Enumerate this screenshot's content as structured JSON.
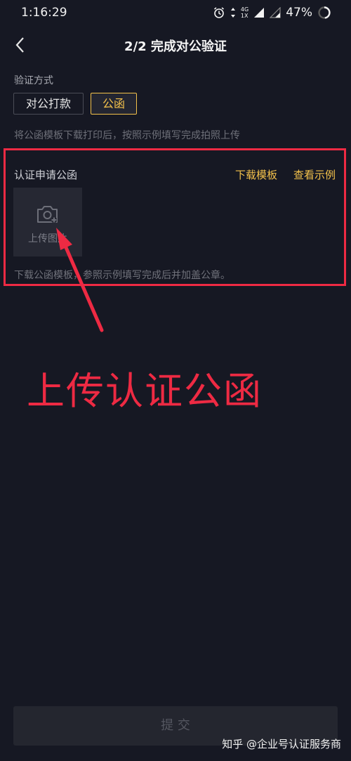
{
  "status_bar": {
    "time": "1:16:29",
    "network_top": "4G",
    "network_bottom": "1X",
    "battery": "47%"
  },
  "nav": {
    "title": "2/2 完成对公验证"
  },
  "verification": {
    "method_label": "验证方式",
    "methods": [
      "对公打款",
      "公函"
    ],
    "selected_method": "公函",
    "hint": "将公函模板下载打印后，按照示例填写完成拍照上传"
  },
  "letter_section": {
    "title": "认证申请公函",
    "download_template": "下载模板",
    "view_example": "查看示例",
    "upload_label": "上传图片",
    "description": "下载公函模板，参照示例填写完成后并加盖公章。"
  },
  "annotation": {
    "text": "上传认证公函",
    "color": "#ee2a43"
  },
  "submit_label": "提 交",
  "watermark": "知乎 @企业号认证服务商",
  "colors": {
    "background": "#161823",
    "accent": "#f3c14b",
    "highlight": "#ee2a43"
  }
}
